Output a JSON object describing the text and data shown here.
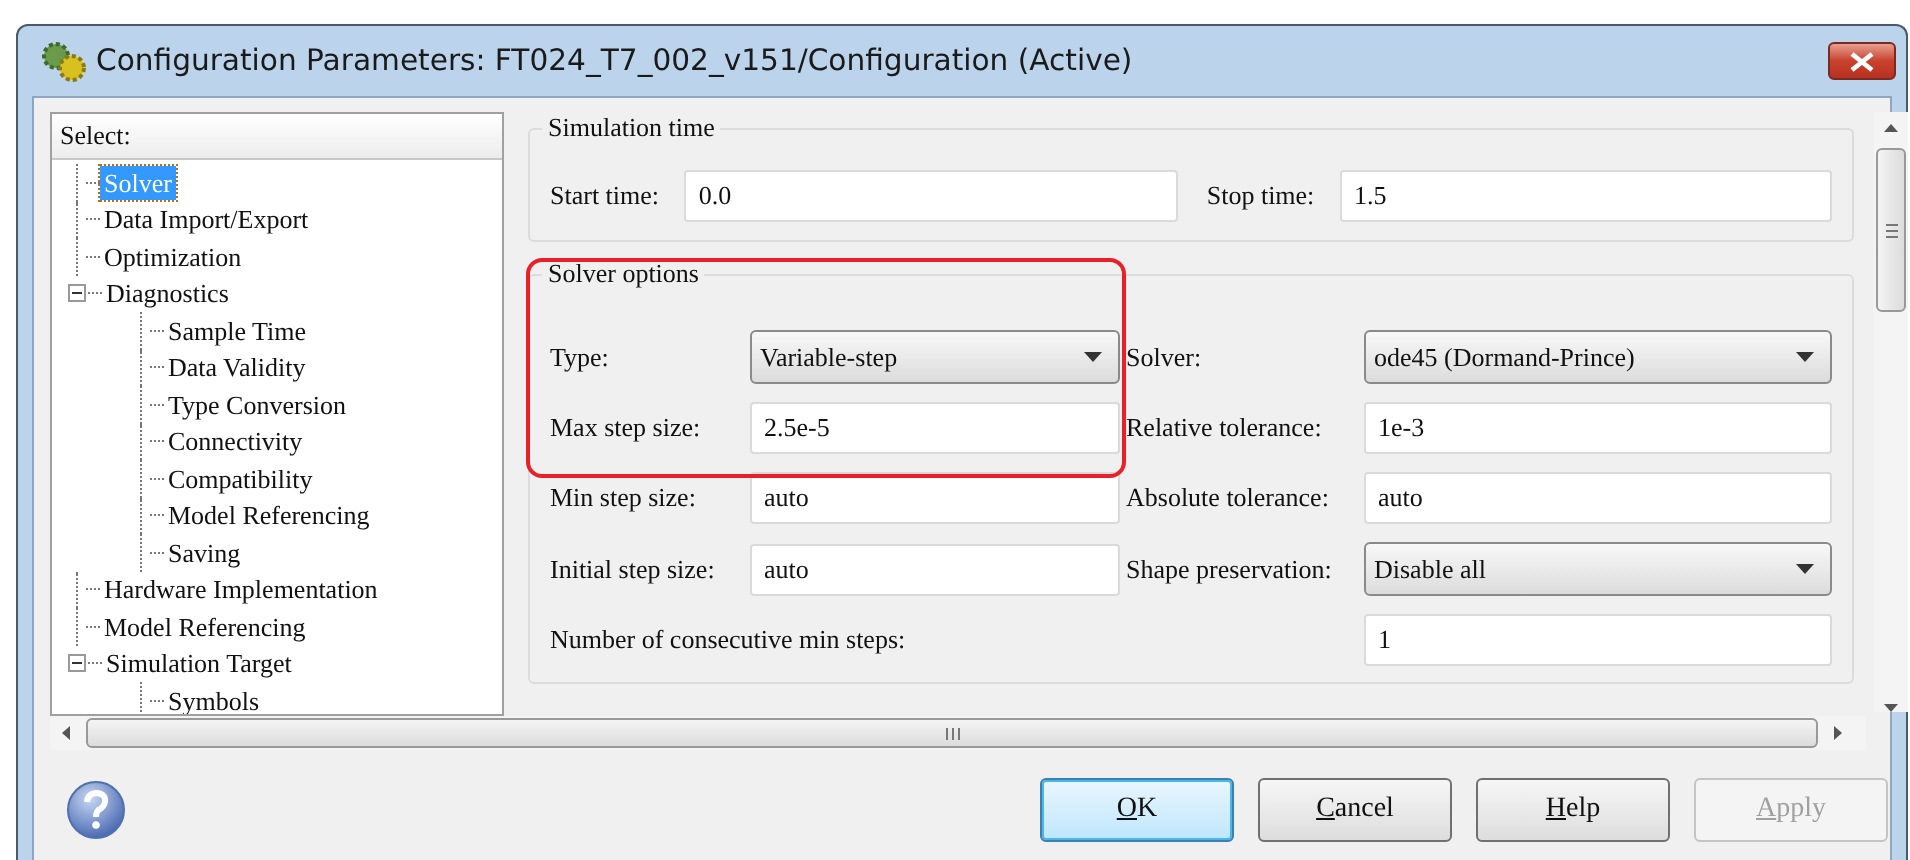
{
  "window": {
    "title": "Configuration Parameters: FT024_T7_002_v151/Configuration (Active)"
  },
  "tree": {
    "header": "Select:",
    "items": [
      {
        "label": "Solver",
        "selected": true
      },
      {
        "label": "Data Import/Export",
        "selected": false
      },
      {
        "label": "Optimization",
        "selected": false
      },
      {
        "label": "Diagnostics",
        "selected": false,
        "expanded": true,
        "children": [
          {
            "label": "Sample Time",
            "selected": false
          },
          {
            "label": "Data Validity",
            "selected": false
          },
          {
            "label": "Type Conversion",
            "selected": false
          },
          {
            "label": "Connectivity",
            "selected": false
          },
          {
            "label": "Compatibility",
            "selected": false
          },
          {
            "label": "Model Referencing",
            "selected": false
          },
          {
            "label": "Saving",
            "selected": false
          }
        ]
      },
      {
        "label": "Hardware Implementation",
        "selected": false
      },
      {
        "label": "Model Referencing",
        "selected": false
      },
      {
        "label": "Simulation Target",
        "selected": false,
        "expanded": true,
        "children": [
          {
            "label": "Symbols",
            "selected": false
          }
        ]
      }
    ]
  },
  "simulation_time": {
    "title": "Simulation time",
    "fields": [
      {
        "label": "Start time:",
        "value": "0.0"
      },
      {
        "label": "Stop time:",
        "value": "1.5"
      }
    ]
  },
  "solver_options": {
    "title": "Solver options",
    "rows": [
      [
        {
          "label": "Type:",
          "kind": "dropdown",
          "value": "Variable-step"
        },
        {
          "label": "Solver:",
          "kind": "dropdown",
          "value": "ode45 (Dormand-Prince)"
        }
      ],
      [
        {
          "label": "Max step size:",
          "kind": "text",
          "value": "2.5e-5"
        },
        {
          "label": "Relative tolerance:",
          "kind": "text",
          "value": "1e-3"
        }
      ],
      [
        {
          "label": "Min step size:",
          "kind": "text",
          "value": "auto"
        },
        {
          "label": "Absolute tolerance:",
          "kind": "text",
          "value": "auto"
        }
      ],
      [
        {
          "label": "Initial step size:",
          "kind": "text",
          "value": "auto"
        },
        {
          "label": "Shape preservation:",
          "kind": "dropdown",
          "value": "Disable all"
        }
      ],
      [
        {
          "label": "Number of consecutive min steps:",
          "kind": "wide",
          "value": "1"
        }
      ]
    ]
  },
  "buttons": [
    {
      "label": "OK",
      "default": true,
      "disabled": false
    },
    {
      "label": "Cancel",
      "default": false,
      "disabled": false
    },
    {
      "label": "Help",
      "default": false,
      "disabled": false
    },
    {
      "label": "Apply",
      "default": false,
      "disabled": true
    }
  ]
}
